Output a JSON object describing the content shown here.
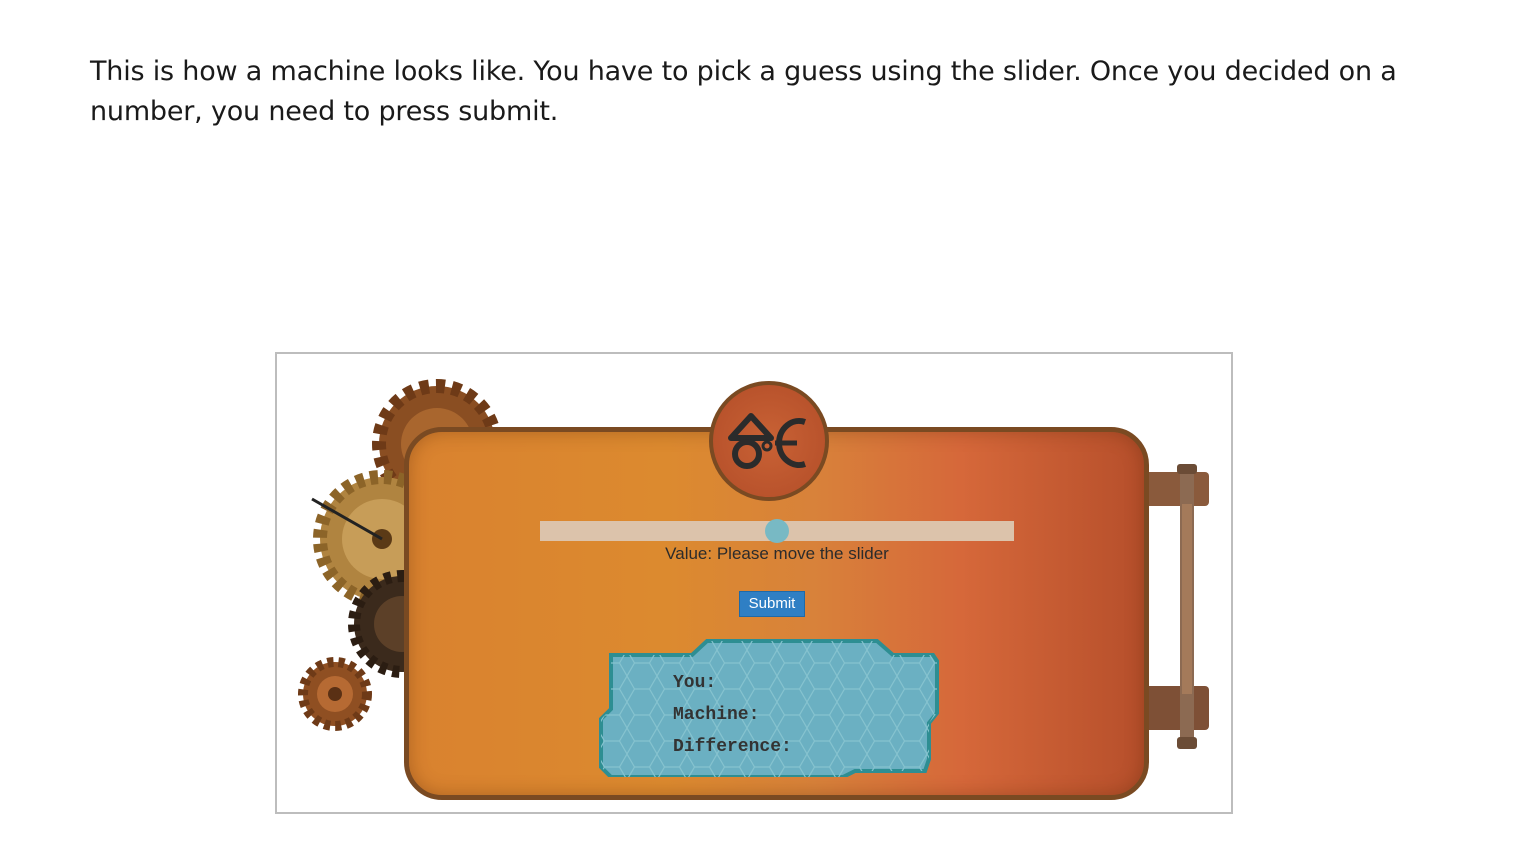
{
  "instructions": "This is how a machine looks like. You have to pick a guess using the slider. Once you decided on a number, you need to press submit.",
  "machine": {
    "emblem_icon": "machine-logo-icon",
    "slider": {
      "value_fraction": 0.5
    },
    "value_label": "Value: Please move the slider",
    "submit_label": "Submit",
    "readout": {
      "you_label": "You:",
      "machine_label": "Machine:",
      "difference_label": "Difference:"
    }
  },
  "colors": {
    "panel": "#d9822f",
    "submit": "#2f7fc4",
    "readout": "#6bb0c2",
    "slider_thumb": "#78b9c4"
  }
}
